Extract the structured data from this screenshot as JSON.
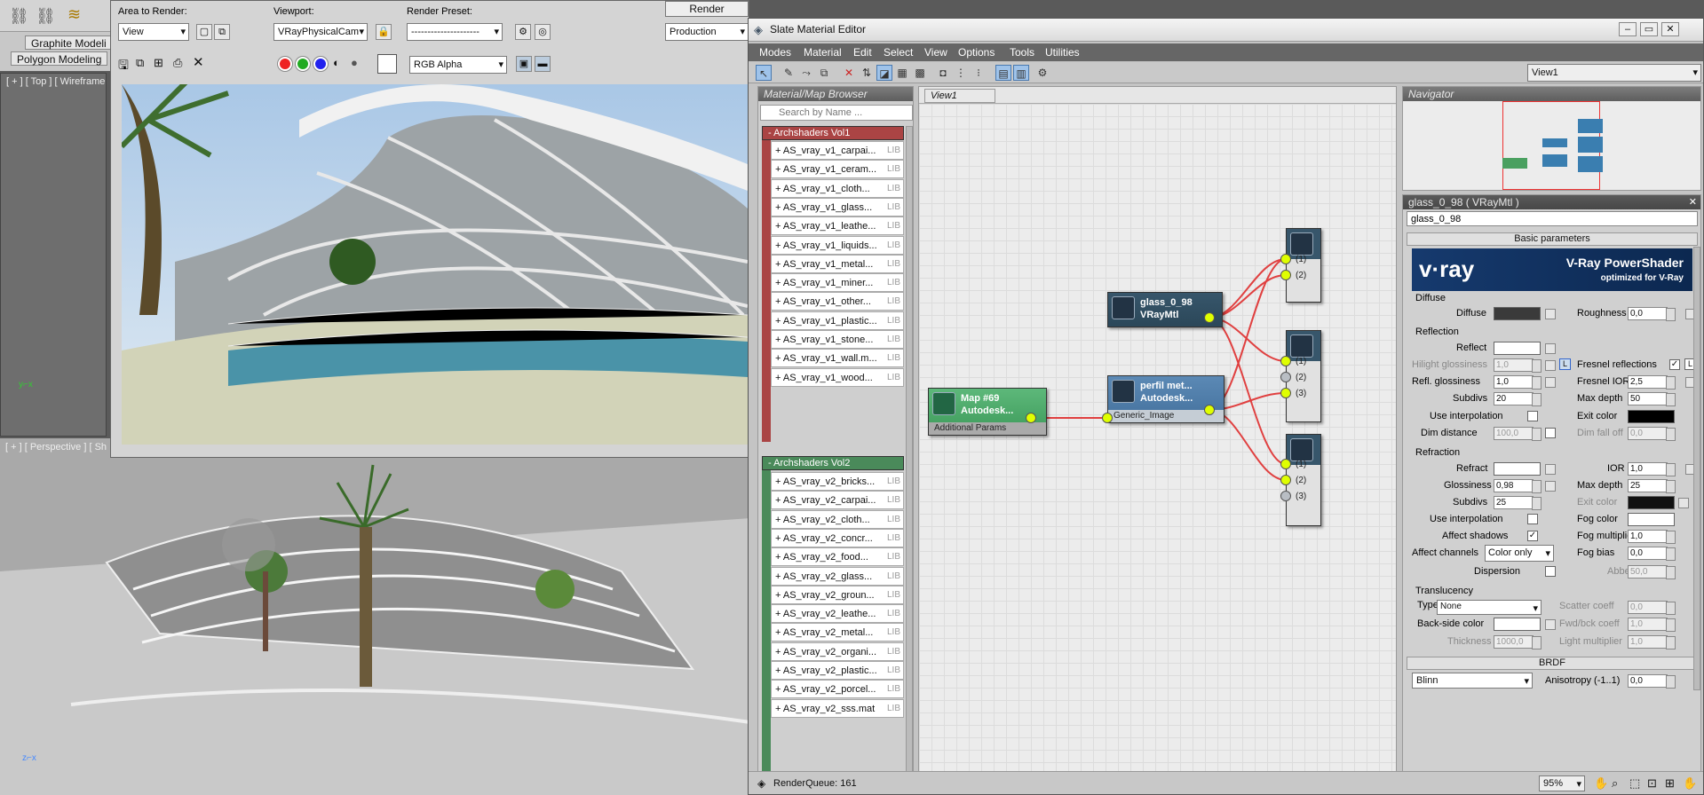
{
  "max": {
    "ribbon_tab1": "Graphite Modeli",
    "ribbon_tab2": "Polygon Modeling",
    "vp_top_label": "[ + ] [ Top ] [ Wireframe",
    "vp_persp_label": "[ + ] [ Perspective ] [ Sh"
  },
  "render_frame": {
    "area_label": "Area to Render:",
    "area_value": "View",
    "viewport_label": "Viewport:",
    "viewport_value": "VRayPhysicalCam",
    "preset_label": "Render Preset:",
    "preset_value": "---------------------",
    "render_button": "Render",
    "production_value": "Production",
    "channel_value": "RGB Alpha"
  },
  "slate": {
    "title": "Slate Material Editor",
    "menus": [
      "Modes",
      "Material",
      "Edit",
      "Select",
      "View",
      "Options",
      "Tools",
      "Utilities"
    ],
    "view_select": "View1",
    "browser": {
      "header": "Material/Map Browser",
      "search_placeholder": "Search by Name ...",
      "group1": "- Archshaders Vol1",
      "group1_items": [
        "+ AS_vray_v1_carpai...",
        "+ AS_vray_v1_ceram...",
        "+ AS_vray_v1_cloth...",
        "+ AS_vray_v1_glass...",
        "+ AS_vray_v1_leathe...",
        "+ AS_vray_v1_liquids...",
        "+ AS_vray_v1_metal...",
        "+ AS_vray_v1_miner...",
        "+ AS_vray_v1_other...",
        "+ AS_vray_v1_plastic...",
        "+ AS_vray_v1_stone...",
        "+ AS_vray_v1_wall.m...",
        "+ AS_vray_v1_wood..."
      ],
      "group2": "- Archshaders Vol2",
      "group2_items": [
        "+ AS_vray_v2_bricks...",
        "+ AS_vray_v2_carpai...",
        "+ AS_vray_v2_cloth...",
        "+ AS_vray_v2_concr...",
        "+ AS_vray_v2_food...",
        "+ AS_vray_v2_glass...",
        "+ AS_vray_v2_groun...",
        "+ AS_vray_v2_leathe...",
        "+ AS_vray_v2_metal...",
        "+ AS_vray_v2_organi...",
        "+ AS_vray_v2_plastic...",
        "+ AS_vray_v2_porcel...",
        "+ AS_vray_v2_sss.mat"
      ],
      "lib_tag": "LIB"
    },
    "view_tab": "View1",
    "nodes": {
      "glass_title": "glass_0_98",
      "glass_sub": "VRayMtl",
      "map_title": "Map #69",
      "map_sub": "Autodesk...",
      "map_slot": "Additional Params",
      "perfil_title": "perfil met...",
      "perfil_sub": "Autodesk...",
      "perfil_slot": "Generic_Image",
      "slot1": "(1)",
      "slot2": "(2)",
      "slot3": "(3)"
    },
    "navigator_header": "Navigator",
    "params": {
      "header": "glass_0_98  ( VRayMtl )",
      "name_value": "glass_0_98",
      "rollout_basic": "Basic parameters",
      "banner_brand": "v·ray",
      "banner_title": "V-Ray PowerShader",
      "banner_sub": "optimized for V-Ray",
      "diffuse_section": "Diffuse",
      "diffuse": "Diffuse",
      "roughness": "Roughness",
      "roughness_val": "0,0",
      "reflection_section": "Reflection",
      "reflect": "Reflect",
      "hilight_gloss": "Hilight glossiness",
      "hilight_val": "1,0",
      "fresnel": "Fresnel reflections",
      "refl_gloss": "Refl. glossiness",
      "refl_gloss_val": "1,0",
      "fresnel_ior": "Fresnel IOR",
      "fresnel_ior_val": "2,5",
      "subdivs": "Subdivs",
      "refl_subdivs_val": "20",
      "max_depth": "Max depth",
      "refl_depth_val": "50",
      "use_interp": "Use interpolation",
      "exit_color": "Exit color",
      "dim_distance": "Dim distance",
      "dim_distance_val": "100,0",
      "dim_falloff": "Dim fall off",
      "dim_falloff_val": "0,0",
      "refraction_section": "Refraction",
      "refract": "Refract",
      "ior": "IOR",
      "ior_val": "1,0",
      "glossiness": "Glossiness",
      "gloss_val": "0,98",
      "refr_depth_val": "25",
      "refr_subdivs_val": "25",
      "fog_color": "Fog color",
      "affect_shadows": "Affect shadows",
      "fog_mult": "Fog multiplier",
      "fog_mult_val": "1,0",
      "affect_channels": "Affect channels",
      "channels_val": "Color only",
      "fog_bias": "Fog bias",
      "fog_bias_val": "0,0",
      "dispersion": "Dispersion",
      "abbe": "Abbe",
      "abbe_val": "50,0",
      "translucency_section": "Translucency",
      "type": "Type",
      "type_val": "None",
      "scatter": "Scatter coeff",
      "scatter_val": "0,0",
      "backside": "Back-side color",
      "fwd_bck": "Fwd/bck coeff",
      "fwd_bck_val": "1,0",
      "thickness": "Thickness",
      "thickness_val": "1000,0",
      "light_mult": "Light multiplier",
      "light_mult_val": "1,0",
      "rollout_brdf": "BRDF",
      "brdf_type": "Blinn",
      "anisotropy": "Anisotropy (-1..1)",
      "anisotropy_val": "0,0"
    },
    "status": "RenderQueue: 161",
    "zoom": "95%"
  }
}
